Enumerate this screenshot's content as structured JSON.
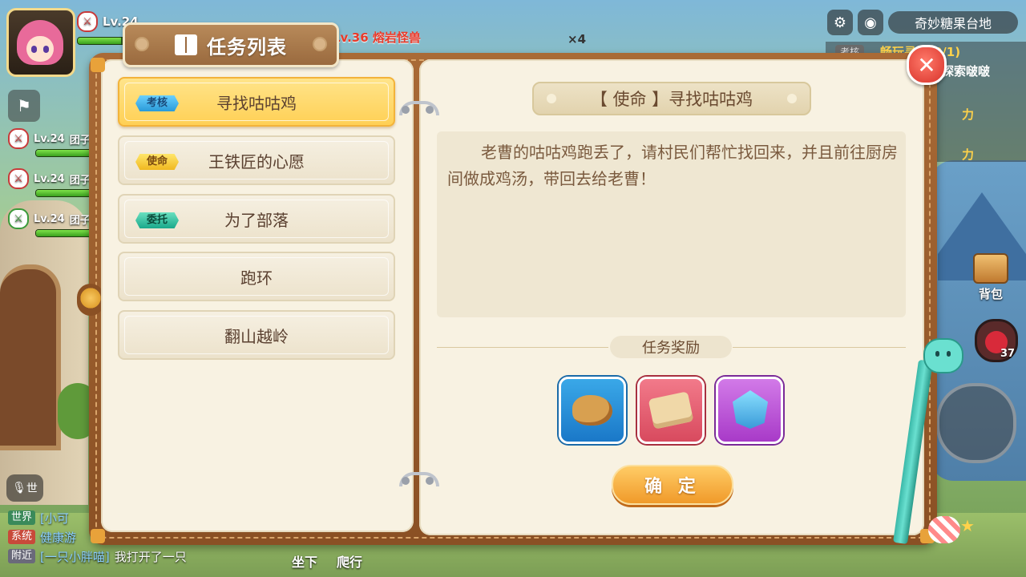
{
  "hud": {
    "player_level": "Lv.24",
    "boss_name": "Lv.36 熔岩怪兽",
    "boss_count": "×4",
    "location": "奇妙糖果台地",
    "settings_icon": "gear-icon",
    "camera_icon": "camera-icon",
    "team": [
      {
        "level": "Lv.24",
        "name": "团子"
      },
      {
        "level": "Lv.24",
        "name": "团子"
      },
      {
        "level": "Lv.24",
        "name": "团子"
      }
    ],
    "quest_tracker": {
      "tag": "考核",
      "line1": "畅玩寻宝(0/1)",
      "line2": "或探索啵啵",
      "line3": "力",
      "line4": "力"
    },
    "bag_label": "背包",
    "potion_count": "37",
    "mic_label": "世",
    "bottom_actions": [
      "坐下",
      "爬行"
    ]
  },
  "chat": [
    {
      "channel": "世界",
      "who": "[小可",
      "text": ""
    },
    {
      "channel": "系统",
      "who": "健康游",
      "text": ""
    },
    {
      "channel": "附近",
      "who": "[一只小胖喵]",
      "text": "我打开了一只"
    }
  ],
  "panel": {
    "title": "任务列表",
    "quests": [
      {
        "badge": "考核",
        "name": "寻找咕咕鸡",
        "active": true
      },
      {
        "badge": "使命",
        "name": "王铁匠的心愿",
        "active": false
      },
      {
        "badge": "委托",
        "name": "为了部落",
        "active": false
      },
      {
        "badge": "",
        "name": "跑环",
        "active": false
      },
      {
        "badge": "",
        "name": "翻山越岭",
        "active": false
      }
    ],
    "detail": {
      "title": "【 使命 】寻找咕咕鸡",
      "description": "老曹的咕咕鸡跑丢了，请村民们帮忙找回来，并且前往厨房间做成鸡汤，带回去给老曹！",
      "reward_label": "任务奖励",
      "rewards": [
        {
          "icon": "cookie-icon",
          "frame": "blue"
        },
        {
          "icon": "cloth-icon",
          "frame": "red"
        },
        {
          "icon": "crystal-icon",
          "frame": "purple"
        }
      ],
      "confirm_label": "确 定"
    },
    "close_icon": "close-icon"
  }
}
